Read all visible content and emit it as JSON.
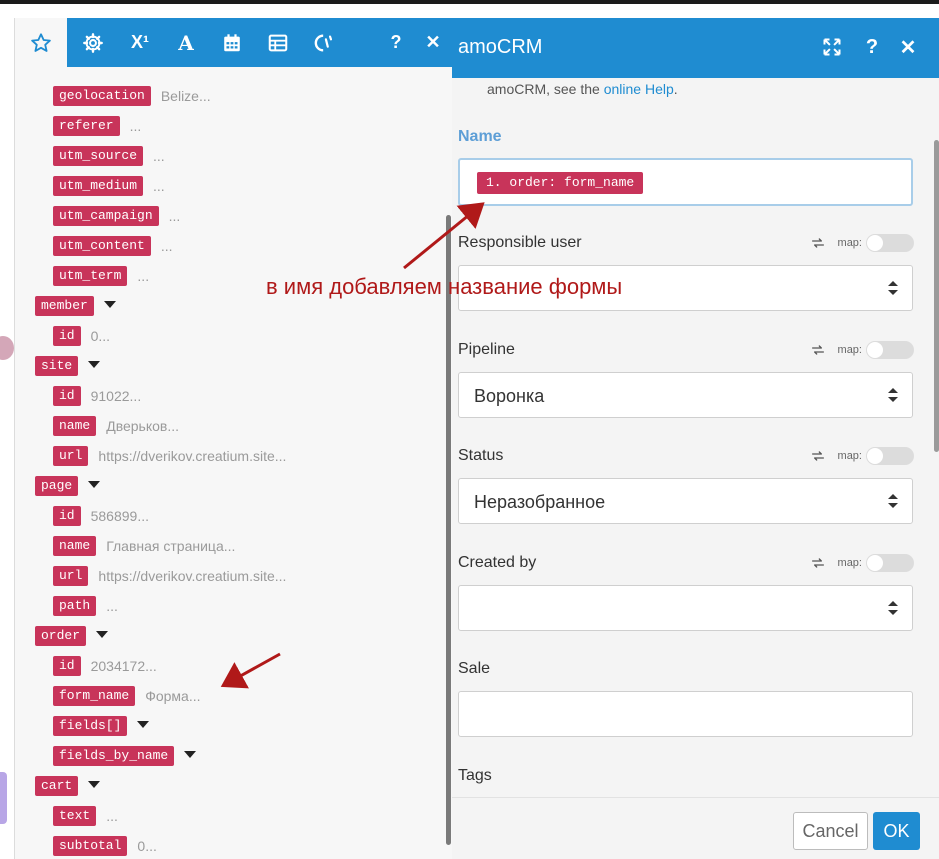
{
  "mapper": {
    "toolbar": [
      {
        "name": "star-icon",
        "kind": "star"
      },
      {
        "name": "gear-icon",
        "kind": "gear"
      },
      {
        "name": "superscript-icon",
        "label": "X¹"
      },
      {
        "name": "text-format-icon",
        "label": "A"
      },
      {
        "name": "calendar-icon",
        "kind": "calendar"
      },
      {
        "name": "table-icon",
        "kind": "table"
      },
      {
        "name": "function-icon",
        "kind": "func"
      },
      {
        "name": "help-icon",
        "label": "?"
      },
      {
        "name": "close-icon",
        "label": "✕"
      }
    ],
    "tree": [
      {
        "key": "geolocation",
        "value": "Belize...",
        "level": 1,
        "caret": false
      },
      {
        "key": "referer",
        "value": "...",
        "level": 1,
        "caret": false
      },
      {
        "key": "utm_source",
        "value": "...",
        "level": 1,
        "caret": false
      },
      {
        "key": "utm_medium",
        "value": "...",
        "level": 1,
        "caret": false
      },
      {
        "key": "utm_campaign",
        "value": "...",
        "level": 1,
        "caret": false
      },
      {
        "key": "utm_content",
        "value": "...",
        "level": 1,
        "caret": false
      },
      {
        "key": "utm_term",
        "value": "...",
        "level": 1,
        "caret": false
      },
      {
        "key": "member",
        "value": "",
        "level": 0,
        "caret": true
      },
      {
        "key": "id",
        "value": "0...",
        "level": 1,
        "caret": false
      },
      {
        "key": "site",
        "value": "",
        "level": 0,
        "caret": true
      },
      {
        "key": "id",
        "value": "91022...",
        "level": 1,
        "caret": false
      },
      {
        "key": "name",
        "value": "Дверьков...",
        "level": 1,
        "caret": false
      },
      {
        "key": "url",
        "value": "https://dverikov.creatium.site...",
        "level": 1,
        "caret": false
      },
      {
        "key": "page",
        "value": "",
        "level": 0,
        "caret": true
      },
      {
        "key": "id",
        "value": "586899...",
        "level": 1,
        "caret": false
      },
      {
        "key": "name",
        "value": "Главная страница...",
        "level": 1,
        "caret": false
      },
      {
        "key": "url",
        "value": "https://dverikov.creatium.site...",
        "level": 1,
        "caret": false
      },
      {
        "key": "path",
        "value": "...",
        "level": 1,
        "caret": false
      },
      {
        "key": "order",
        "value": "",
        "level": 0,
        "caret": true
      },
      {
        "key": "id",
        "value": "2034172...",
        "level": 1,
        "caret": false
      },
      {
        "key": "form_name",
        "value": "Форма...",
        "level": 1,
        "caret": false
      },
      {
        "key": "fields[]",
        "value": "",
        "level": 1,
        "caret": true
      },
      {
        "key": "fields_by_name",
        "value": "",
        "level": 1,
        "caret": true
      },
      {
        "key": "cart",
        "value": "",
        "level": 0,
        "caret": true
      },
      {
        "key": "text",
        "value": "...",
        "level": 1,
        "caret": false
      },
      {
        "key": "subtotal",
        "value": "0...",
        "level": 1,
        "caret": false
      }
    ]
  },
  "dialog": {
    "title": "amoCRM",
    "help_prefix": "amoCRM, see the",
    "help_link": "online Help",
    "help_suffix": ".",
    "name_label": "Name",
    "name_chip": "1. order: form_name",
    "map_label": "map:",
    "responsible_label": "Responsible user",
    "pipeline_label": "Pipeline",
    "pipeline_value": "Воронка",
    "status_label": "Status",
    "status_value": "Неразобранное",
    "created_by_label": "Created by",
    "sale_label": "Sale",
    "tags_label": "Tags",
    "cancel_label": "Cancel",
    "ok_label": "OK"
  },
  "annotation": {
    "text": "в имя добавляем название формы",
    "color": "#b01919"
  },
  "colors": {
    "brand": "#1f8cd1",
    "pill": "#c8345a"
  }
}
